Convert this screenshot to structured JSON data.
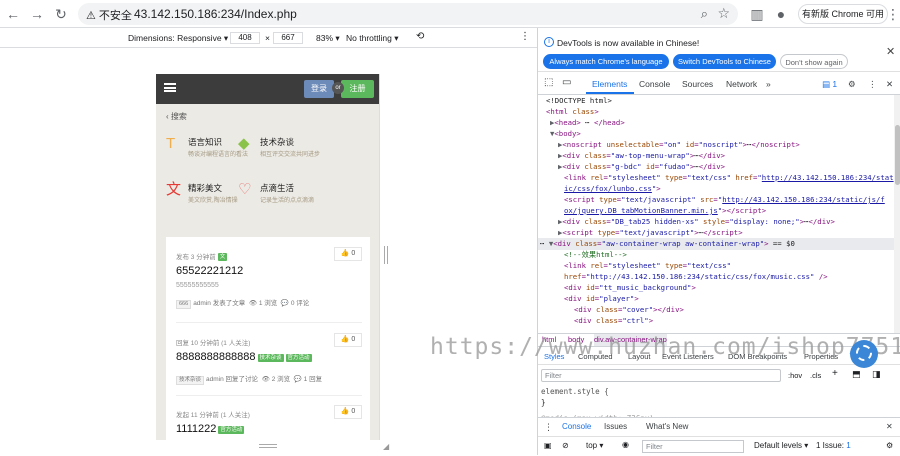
{
  "browser": {
    "security": "不安全",
    "url": "43.142.150.186:234/Index.php",
    "update_button": "有新版 Chrome 可用"
  },
  "device_toolbar": {
    "dimensions": "Dimensions: Responsive",
    "width": "408",
    "times": "×",
    "height": "667",
    "zoom": "83%",
    "throttling": "No throttling"
  },
  "phone": {
    "login": "登录",
    "or": "or",
    "register": "注册",
    "search": "搜索",
    "categories": [
      {
        "icon": "T",
        "title": "语言知识",
        "desc": "畅谈对编程语言的看法",
        "color": "#f0ad4e"
      },
      {
        "icon": "◆",
        "title": "技术杂谈",
        "desc": "相互评交交流共同进步",
        "color": "#8bc34a"
      },
      {
        "icon": "文",
        "title": "精彩美文",
        "desc": "美文欣赏,陶冶情操",
        "color": "#e53935"
      },
      {
        "icon": "♡",
        "title": "点滴生活",
        "desc": "记录生活的点点滴滴",
        "color": "#e57373"
      }
    ],
    "posts": [
      {
        "meta": "发布 3 分钟前",
        "meta_badge": "文",
        "likes": "0",
        "title": "65522221212",
        "sub": "55555555555",
        "tag": "666",
        "author": "admin",
        "action": "发表了文章",
        "views": "1 浏览",
        "comments": "0 评论"
      },
      {
        "meta": "回复 10 分钟前 (1 人关注)",
        "likes": "0",
        "title": "8888888888888",
        "title_badges": [
          "技术杂谈",
          "官方活动"
        ],
        "tag": "技术杂谈",
        "author": "admin",
        "action": "回复了讨论",
        "views": "2 浏览",
        "comments": "1 回复"
      },
      {
        "meta": "发起 11 分钟前 (1 人关注)",
        "likes": "0",
        "title": "1111222",
        "title_badges": [
          "官方活动"
        ]
      }
    ]
  },
  "devtools": {
    "notice": "DevTools is now available in Chinese!",
    "btn_match": "Always match Chrome's language",
    "btn_switch": "Switch DevTools to Chinese",
    "btn_dont": "Don't show again",
    "tabs": [
      "Elements",
      "Console",
      "Sources",
      "Network"
    ],
    "issues_count": "1",
    "breadcrumb": [
      "html",
      "body",
      "div.aw-container-wrap"
    ],
    "style_tabs": [
      "Styles",
      "Computed",
      "Layout",
      "Event Listeners",
      "DOM Breakpoints",
      "Properties"
    ],
    "filter_placeholder": "Filter",
    "hov": ":hov",
    "cls": ".cls",
    "styles_line1": "element.style {",
    "styles_line2": "}",
    "styles_line3": "@media (max-width: 736px)",
    "drawer_tabs": [
      "Console",
      "Issues",
      "What's New"
    ],
    "console_context": "top",
    "console_filter": "Filter",
    "levels": "Default levels",
    "issue_count": "1 Issue: ",
    "issue_num": "1"
  },
  "watermark": "https://www.huzhan.com/ishop7751"
}
